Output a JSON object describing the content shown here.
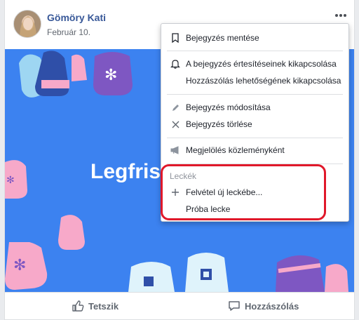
{
  "post": {
    "author": "Gömöry Kati",
    "date": "Február 10.",
    "banner_title": "Legfris"
  },
  "menu": {
    "items": [
      {
        "label": "Bejegyzés mentése",
        "icon": "bookmark-icon"
      },
      {
        "label": "A bejegyzés értesítéseinek kikapcsolása",
        "icon": "bell-icon"
      },
      {
        "label": "Hozzászólás lehetőségének kikapcsolása",
        "icon": ""
      },
      {
        "label": "Bejegyzés módosítása",
        "icon": "pencil-icon"
      },
      {
        "label": "Bejegyzés törlése",
        "icon": "close-icon"
      },
      {
        "label": "Megjelölés közleményként",
        "icon": "megaphone-icon"
      }
    ],
    "section_label": "Leckék",
    "section_items": [
      {
        "label": "Felvétel új leckébe...",
        "icon": "plus-icon"
      },
      {
        "label": "Próba lecke",
        "icon": ""
      }
    ]
  },
  "actions": {
    "like": "Tetszik",
    "comment": "Hozzászólás"
  },
  "colors": {
    "banner": "#3c82f0",
    "link": "#385898",
    "highlight": "#e0182a"
  }
}
